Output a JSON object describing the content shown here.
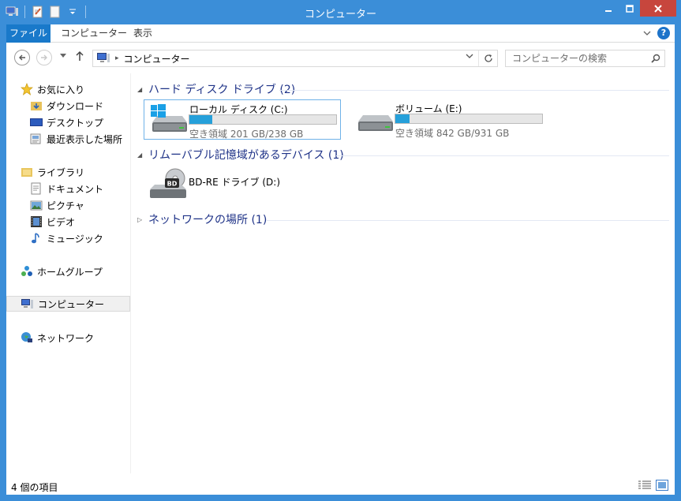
{
  "window": {
    "title": "コンピューター"
  },
  "ribbon": {
    "tabs": [
      {
        "label": "ファイル"
      },
      {
        "label": "コンピューター"
      },
      {
        "label": "表示"
      }
    ],
    "help": "?"
  },
  "nav": {
    "address": "コンピューター",
    "search_placeholder": "コンピューターの検索"
  },
  "sidebar": {
    "favorites": {
      "label": "お気に入り",
      "items": [
        {
          "label": "ダウンロード"
        },
        {
          "label": "デスクトップ"
        },
        {
          "label": "最近表示した場所"
        }
      ]
    },
    "libraries": {
      "label": "ライブラリ",
      "items": [
        {
          "label": "ドキュメント"
        },
        {
          "label": "ピクチャ"
        },
        {
          "label": "ビデオ"
        },
        {
          "label": "ミュージック"
        }
      ]
    },
    "homegroup": "ホームグループ",
    "computer": "コンピューター",
    "network": "ネットワーク"
  },
  "groups": {
    "hdd": {
      "title": "ハード ディスク ドライブ (2)"
    },
    "removable": {
      "title": "リムーバブル記憶域があるデバイス (1)"
    },
    "network": {
      "title": "ネットワークの場所 (1)"
    }
  },
  "drives": [
    {
      "name": "ローカル ディスク (C:)",
      "free": "空き領域 201 GB/238 GB",
      "used_fraction": 0.155
    },
    {
      "name": "ボリューム (E:)",
      "free": "空き領域 842 GB/931 GB",
      "used_fraction": 0.096
    }
  ],
  "optical": {
    "name": "BD-RE ドライブ (D:)",
    "badge": "BD"
  },
  "status": {
    "text": "4 個の項目"
  },
  "colors": {
    "accent": "#3b8ed8",
    "file_tab": "#1979ca",
    "bar": "#26a0da",
    "group_header": "#1e3287",
    "close": "#c7463d"
  }
}
